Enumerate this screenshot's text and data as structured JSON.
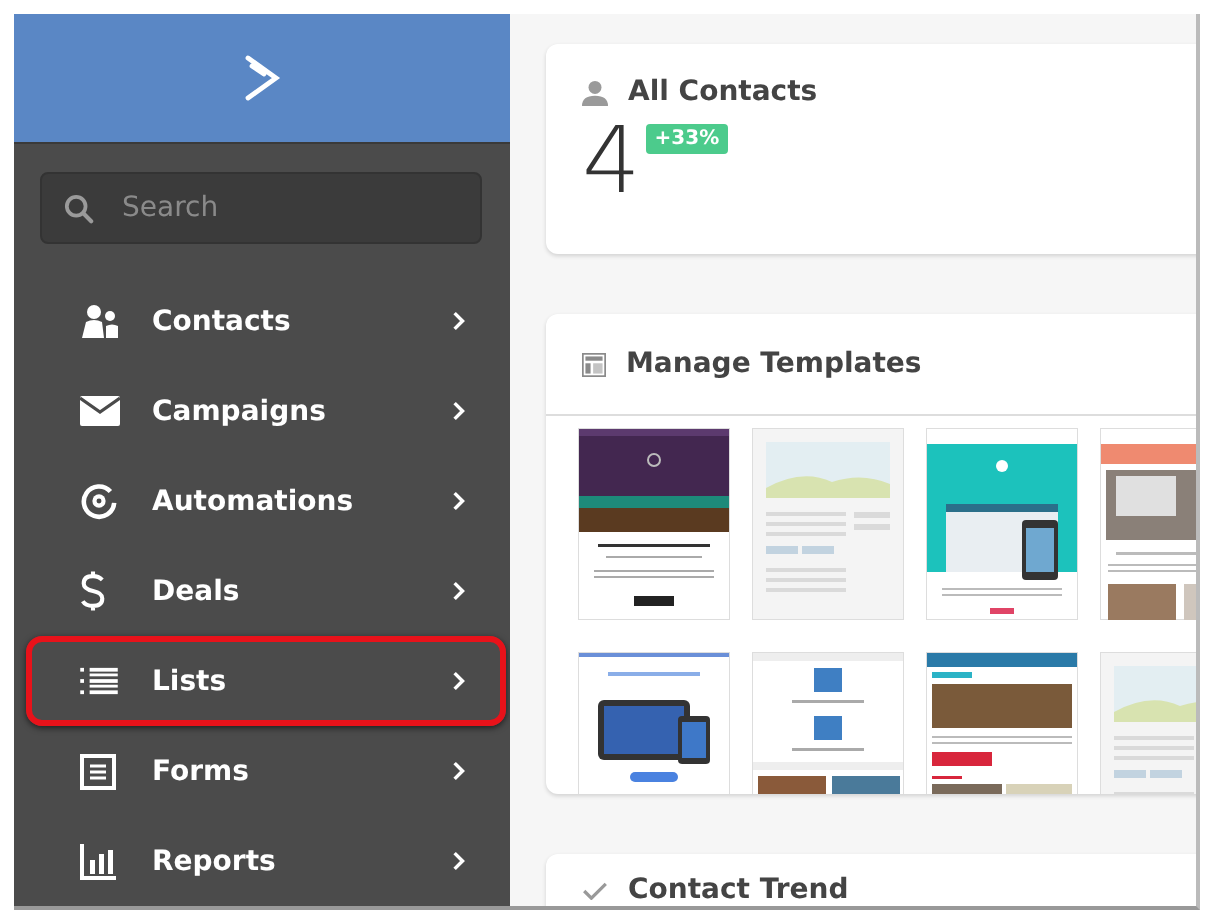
{
  "sidebar": {
    "search": {
      "placeholder": "Search"
    },
    "items": [
      {
        "label": "Contacts",
        "highlighted": false
      },
      {
        "label": "Campaigns",
        "highlighted": false
      },
      {
        "label": "Automations",
        "highlighted": false
      },
      {
        "label": "Deals",
        "highlighted": false
      },
      {
        "label": "Lists",
        "highlighted": true
      },
      {
        "label": "Forms",
        "highlighted": false
      },
      {
        "label": "Reports",
        "highlighted": false
      }
    ]
  },
  "contacts_card": {
    "title": "All Contacts",
    "count": "4",
    "change": "+33%"
  },
  "templates_card": {
    "title": "Manage Templates",
    "templates": [
      {
        "kind": "dark-banner"
      },
      {
        "kind": "landscape"
      },
      {
        "kind": "teal-device"
      },
      {
        "kind": "photo-header"
      },
      {
        "kind": "tablet"
      },
      {
        "kind": "image-blocks"
      },
      {
        "kind": "photo-article"
      },
      {
        "kind": "landscape"
      }
    ]
  },
  "trend_card": {
    "title": "Contact Trend"
  }
}
